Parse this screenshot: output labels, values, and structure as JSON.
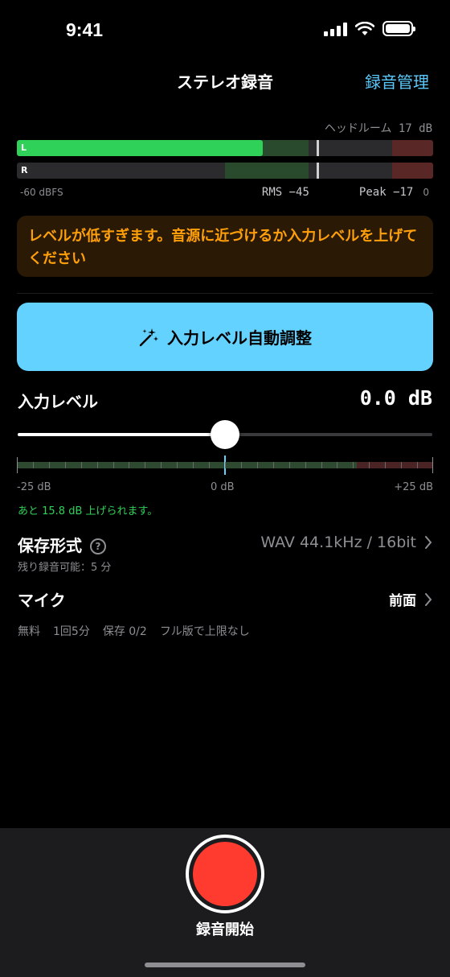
{
  "status": {
    "time": "9:41"
  },
  "nav": {
    "title": "ステレオ録音",
    "action": "録音管理"
  },
  "meter": {
    "headroom": "ヘッドルーム 17 dB",
    "channels": [
      {
        "label": "L",
        "peak_fraction": 0.59,
        "rms_fraction": 0.7,
        "hold_fraction": 0.72
      },
      {
        "label": "R",
        "peak_fraction": 0.0,
        "rms_fraction": 0.7,
        "hold_fraction": 0.72,
        "rms_start_fraction": 0.5
      }
    ],
    "scale_min": "-60 dBFS",
    "rms": "RMS −45",
    "peak": "Peak −17",
    "scale_max": "0",
    "colors": {
      "peak": "#30d158",
      "rms": "#2a4a2e",
      "hot": "#5a2727"
    }
  },
  "warning": {
    "text": "レベルが低すぎます。音源に近づけるか入力レベルを上げてください",
    "color": "#ff9f0a"
  },
  "auto_adjust": {
    "label": "入力レベル自動調整",
    "icon": "magic-wand-icon",
    "color": "#64d2ff"
  },
  "input_level": {
    "label": "入力レベル",
    "value": "0.0 dB",
    "slider_fraction": 0.5,
    "ruler": {
      "min": "-25 dB",
      "mid": "0 dB",
      "max": "+25 dB"
    },
    "hint": "あと 15.8 dB 上げられます。"
  },
  "format": {
    "label": "保存形式",
    "help_icon": "?",
    "value": "WAV 44.1kHz / 16bit",
    "remaining": "残り録音可能：5 分"
  },
  "mic": {
    "label": "マイク",
    "value": "前面"
  },
  "plan": {
    "tier": "無料",
    "per_take": "1回5分",
    "saved": "保存 0/2",
    "upgrade": "フル版で上限なし"
  },
  "record": {
    "label": "録音開始",
    "color": "#ff3b30"
  }
}
